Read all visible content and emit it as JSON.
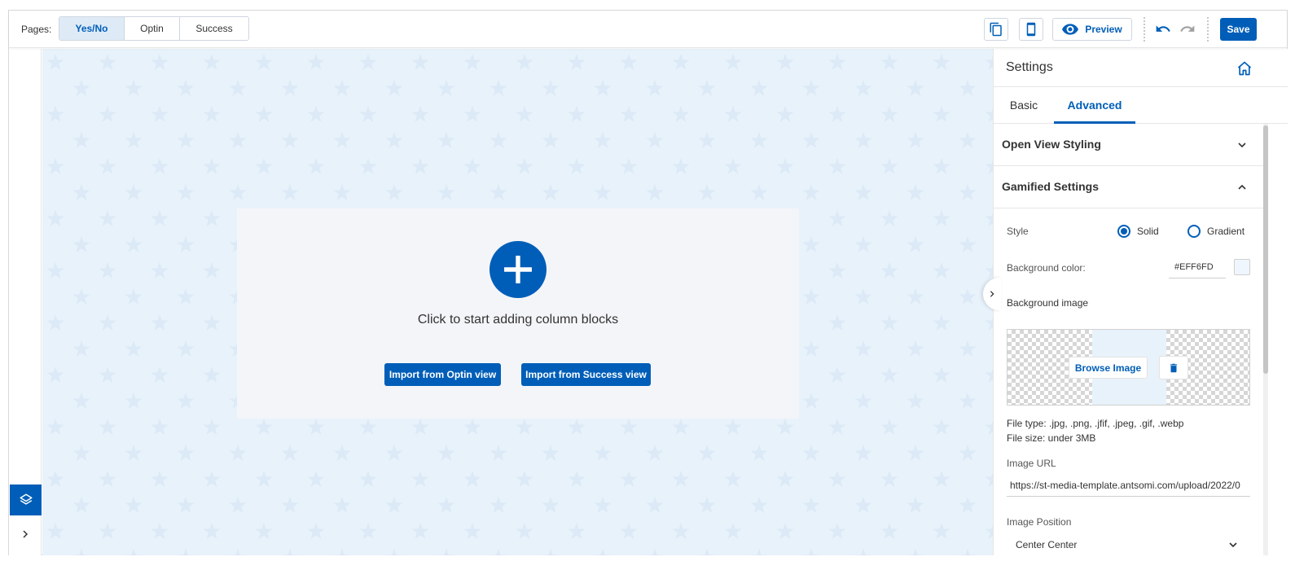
{
  "topbar": {
    "pages_label": "Pages:",
    "page_tabs": [
      "Yes/No",
      "Optin",
      "Success"
    ],
    "active_page": "Yes/No",
    "preview_label": "Preview",
    "save_label": "Save",
    "icons": [
      "copy-icon",
      "mobile-icon",
      "eye-icon",
      "undo-icon",
      "redo-icon"
    ]
  },
  "canvas": {
    "background_color": "#e8f2fb",
    "drop_text": "Click to start adding column blocks",
    "import_optin_label": "Import from Optin view",
    "import_success_label": "Import from Success view"
  },
  "panel": {
    "title": "Settings",
    "tabs": [
      "Basic",
      "Advanced"
    ],
    "active_tab": "Advanced",
    "sections": [
      {
        "title": "Open View Styling",
        "expanded": false
      },
      {
        "title": "Gamified Settings",
        "expanded": true
      }
    ],
    "style_label": "Style",
    "style_options": [
      "Solid",
      "Gradient"
    ],
    "style_selected": "Solid",
    "bg_color_label": "Background color:",
    "bg_color_value": "#EFF6FD",
    "bg_image_label": "Background image",
    "browse_label": "Browse Image",
    "file_type": "File type: .jpg, .png, .jfif, .jpeg, .gif, .webp",
    "file_size": "File size: under 3MB",
    "image_url_label": "Image URL",
    "image_url_value": "https://st-media-template.antsomi.com/upload/2022/0",
    "image_position_label": "Image Position",
    "image_position_value": "Center Center"
  },
  "colors": {
    "primary": "#005eb8",
    "canvas_bg": "#e8f2fb"
  }
}
